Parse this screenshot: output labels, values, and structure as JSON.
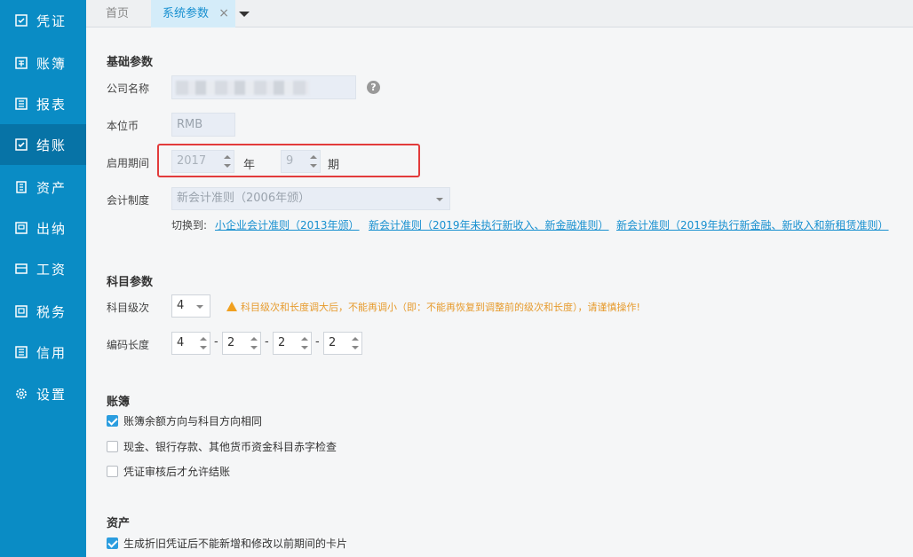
{
  "sidebar": {
    "items": [
      {
        "label": "凭证",
        "icon": "voucher-icon"
      },
      {
        "label": "账簿",
        "icon": "ledger-icon"
      },
      {
        "label": "报表",
        "icon": "report-icon"
      },
      {
        "label": "结账",
        "icon": "checkout-icon",
        "active": true
      },
      {
        "label": "资产",
        "icon": "asset-icon"
      },
      {
        "label": "出纳",
        "icon": "cashier-icon"
      },
      {
        "label": "工资",
        "icon": "salary-icon"
      },
      {
        "label": "税务",
        "icon": "tax-icon"
      },
      {
        "label": "信用",
        "icon": "credit-icon"
      },
      {
        "label": "设置",
        "icon": "gear-icon"
      }
    ]
  },
  "tabs": {
    "home": "首页",
    "active": "系统参数",
    "close": "×"
  },
  "basic": {
    "title": "基础参数",
    "company_label": "公司名称",
    "help": "?",
    "currency_label": "本位币",
    "currency_value": "RMB",
    "period_label": "启用期间",
    "year_value": "2017",
    "year_unit": "年",
    "period_value": "9",
    "period_unit": "期",
    "accounting_label": "会计制度",
    "accounting_value": "新会计准则（2006年颁）",
    "switch_label": "切换到:",
    "switch_links": [
      "小企业会计准则（2013年颁）",
      "新会计准则（2019年未执行新收入、新金融准则）",
      "新会计准则（2019年执行新金融、新收入和新租赁准则）"
    ]
  },
  "subject": {
    "title": "科目参数",
    "level_label": "科目级次",
    "level_value": "4",
    "warning": "科目级次和长度调大后，不能再调小（即：不能再恢复到调整前的级次和长度），请谨慎操作!",
    "code_label": "编码长度",
    "code_values": [
      "4",
      "2",
      "2",
      "2"
    ],
    "dash": "-"
  },
  "ledger": {
    "title": "账簿",
    "options": [
      {
        "label": "账簿余额方向与科目方向相同",
        "checked": true
      },
      {
        "label": "现金、银行存款、其他货币资金科目赤字检查",
        "checked": false
      },
      {
        "label": "凭证审核后才允许结账",
        "checked": false
      }
    ]
  },
  "asset": {
    "title": "资产",
    "options": [
      {
        "label": "生成折旧凭证后不能新增和修改以前期间的卡片",
        "checked": true
      }
    ]
  },
  "colors": {
    "sidebar": "#0a8cc5",
    "sidebar_active": "#0773a6",
    "link": "#1890d0",
    "warning": "#e69b2e",
    "highlight": "#e23b3b"
  }
}
